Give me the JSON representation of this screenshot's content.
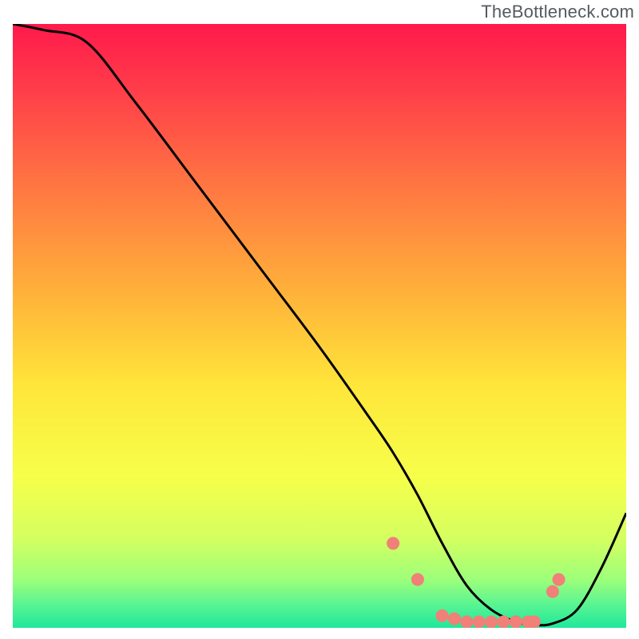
{
  "watermark": {
    "text": "TheBottleneck.com"
  },
  "chart_data": {
    "type": "line",
    "title": "",
    "xlabel": "",
    "ylabel": "",
    "xlim": [
      0,
      100
    ],
    "ylim": [
      0,
      100
    ],
    "grid": false,
    "legend": false,
    "series": [
      {
        "name": "curve",
        "stroke": "#000000",
        "x": [
          0,
          5,
          12,
          20,
          30,
          40,
          50,
          58,
          62,
          66,
          70,
          74,
          78,
          82,
          85,
          88,
          92,
          96,
          100
        ],
        "values": [
          100,
          99,
          97,
          87,
          73.5,
          60,
          46.5,
          35,
          29,
          22,
          14,
          7,
          3,
          1,
          0.5,
          0.7,
          3,
          10,
          19
        ]
      }
    ],
    "markers": {
      "name": "dots",
      "color": "#f08078",
      "x": [
        62,
        66,
        70,
        72,
        74,
        76,
        78,
        80,
        82,
        84,
        85,
        88,
        89
      ],
      "values": [
        14,
        8,
        2,
        1.5,
        1,
        1,
        1,
        1,
        1,
        1,
        1,
        6,
        8
      ]
    },
    "background_gradient": {
      "stops": [
        {
          "pct": 0,
          "color": "#ff1a4b"
        },
        {
          "pct": 10,
          "color": "#ff3a4a"
        },
        {
          "pct": 25,
          "color": "#ff7043"
        },
        {
          "pct": 45,
          "color": "#ffb33a"
        },
        {
          "pct": 60,
          "color": "#ffe63a"
        },
        {
          "pct": 75,
          "color": "#f6ff4a"
        },
        {
          "pct": 85,
          "color": "#d5ff60"
        },
        {
          "pct": 92,
          "color": "#9dff7a"
        },
        {
          "pct": 96,
          "color": "#5cf592"
        },
        {
          "pct": 100,
          "color": "#1fe89a"
        }
      ]
    }
  }
}
